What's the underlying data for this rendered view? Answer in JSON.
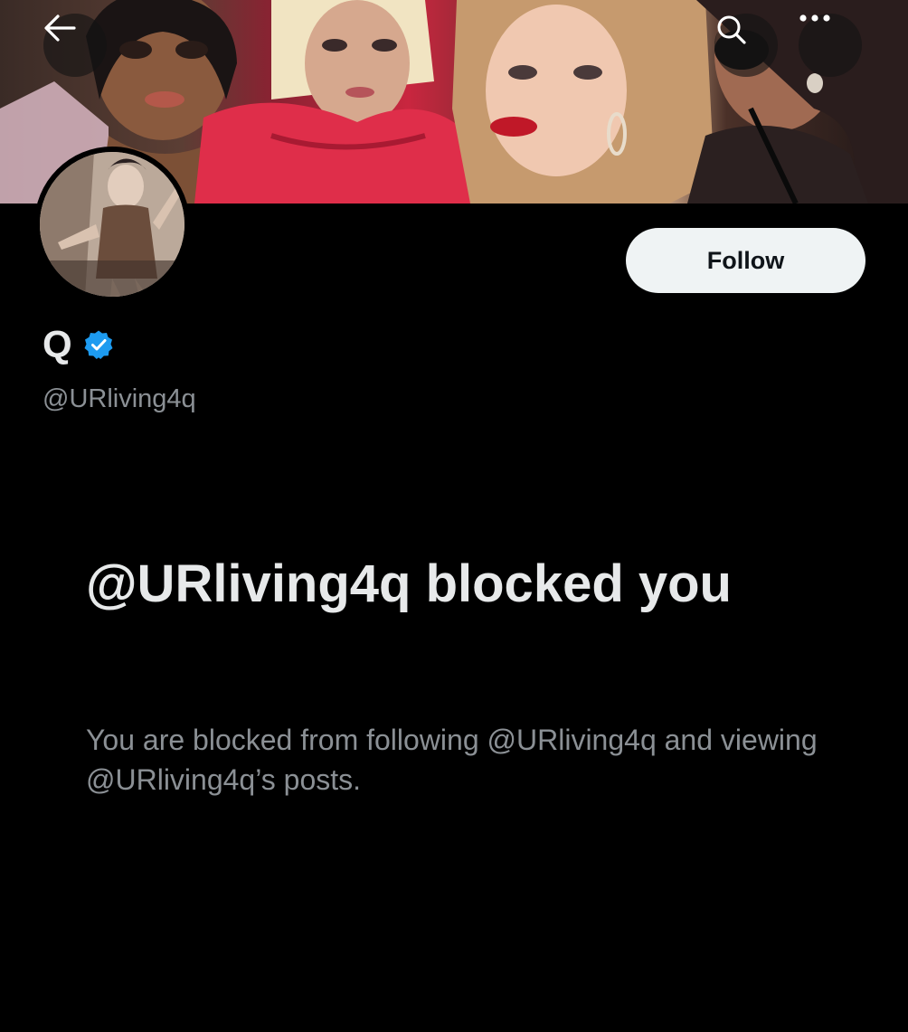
{
  "banner": {
    "image": "group-photo-banner"
  },
  "nav": {
    "back_icon": "arrow-left-icon",
    "search_icon": "search-icon",
    "more_icon": "more-horizontal-icon"
  },
  "profile": {
    "display_name": "Q",
    "verified": true,
    "verified_color": "#1d9bf0",
    "handle": "@URliving4q",
    "follow_label": "Follow"
  },
  "blocked": {
    "title": "@URliving4q blocked you",
    "description": "You are blocked from following @URliving4q and viewing @URliving4q’s posts."
  },
  "colors": {
    "background": "#000000",
    "primary_text": "#e7e9ea",
    "secondary_text": "#8b9095",
    "follow_bg": "#eff3f4",
    "follow_text": "#0f1419"
  }
}
